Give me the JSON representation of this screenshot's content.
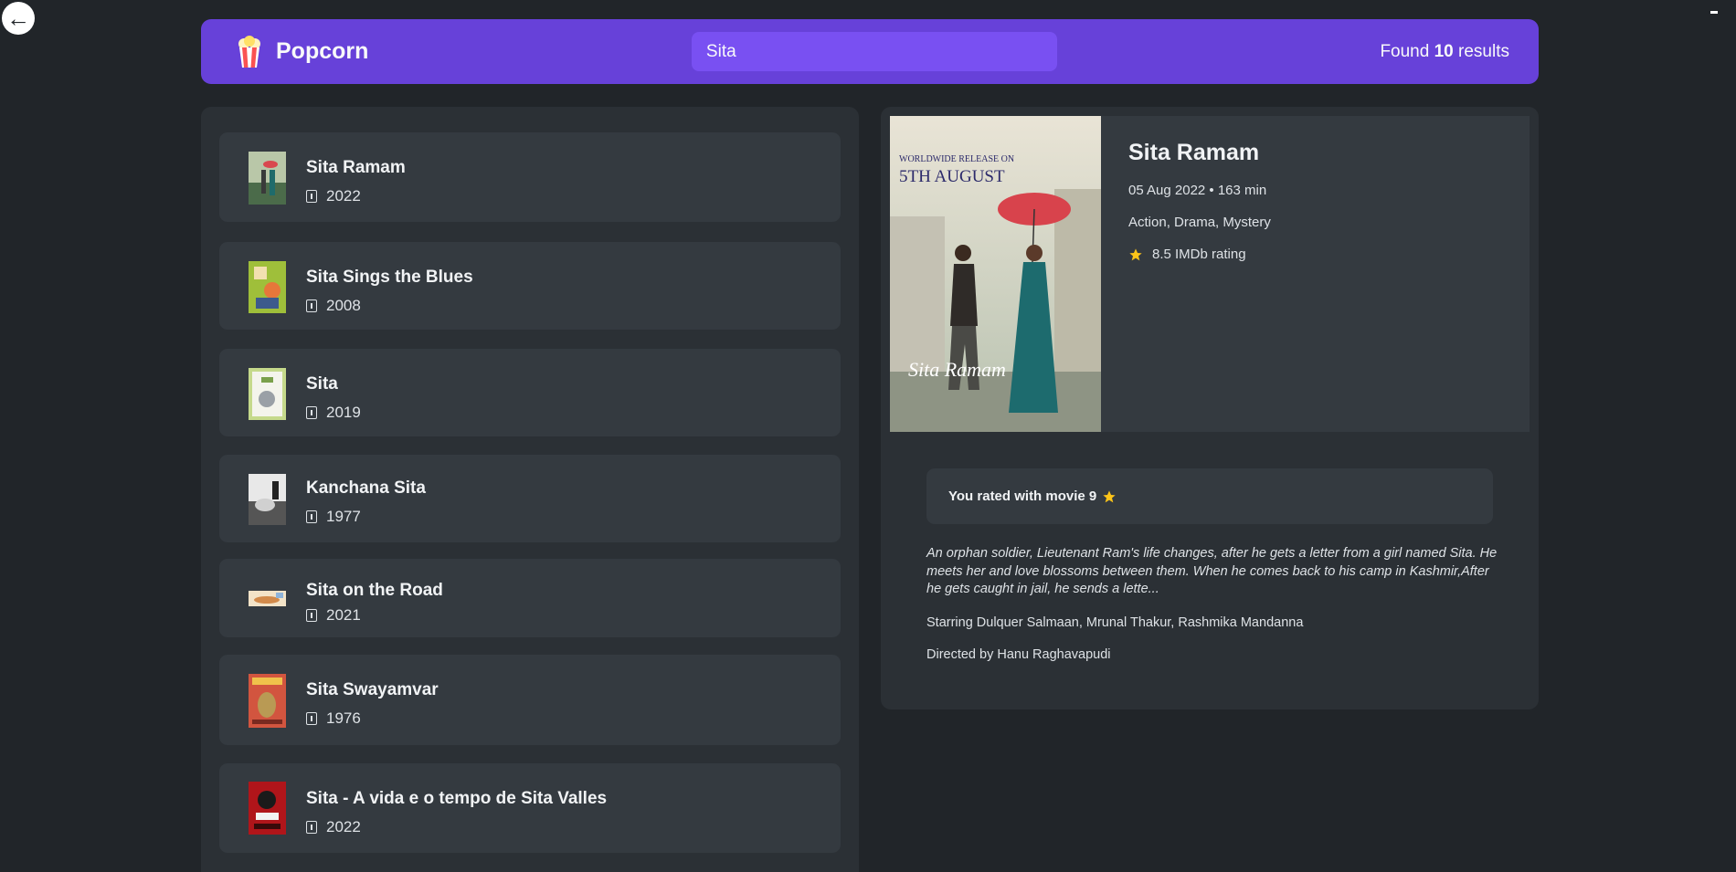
{
  "back_icon": "left-arrow-icon",
  "navbar": {
    "logo_icon": "popcorn-icon",
    "logo_text": "Popcorn",
    "search_value": "Sita",
    "search_placeholder": "Search movies...",
    "results_prefix": "Found",
    "results_count": "10",
    "results_suffix": "results",
    "brand_color": "#6741d9"
  },
  "movies": [
    {
      "title": "Sita Ramam",
      "year": "2022",
      "year_icon": "calendar-icon"
    },
    {
      "title": "Sita Sings the Blues",
      "year": "2008",
      "year_icon": "calendar-icon"
    },
    {
      "title": "Sita",
      "year": "2019",
      "year_icon": "calendar-icon"
    },
    {
      "title": "Kanchana Sita",
      "year": "1977",
      "year_icon": "calendar-icon"
    },
    {
      "title": "Sita on the Road",
      "year": "2021",
      "year_icon": "calendar-icon"
    },
    {
      "title": "Sita Swayamvar",
      "year": "1976",
      "year_icon": "calendar-icon"
    },
    {
      "title": "Sita - A vida e o tempo de Sita Valles",
      "year": "2022",
      "year_icon": "calendar-icon"
    }
  ],
  "details": {
    "title": "Sita Ramam",
    "release_runtime": "05 Aug 2022 • 163 min",
    "genre": "Action, Drama, Mystery",
    "rating_icon": "star-icon",
    "rating": "8.5 IMDb rating",
    "user_rating": "You rated with movie 9",
    "plot": "An orphan soldier, Lieutenant Ram's life changes, after he gets a letter from a girl named Sita. He meets her and love blossoms between them. When he comes back to his camp in Kashmir,After he gets caught in jail, he sends a lette...",
    "starring": "Starring Dulquer Salmaan, Mrunal Thakur, Rashmika Mandanna",
    "director": "Directed by Hanu Raghavapudi",
    "poster": {
      "headline_1": "WORLDWIDE RELEASE ON",
      "headline_2": "5TH AUGUST",
      "logo_text": "Sita Ramam"
    }
  }
}
